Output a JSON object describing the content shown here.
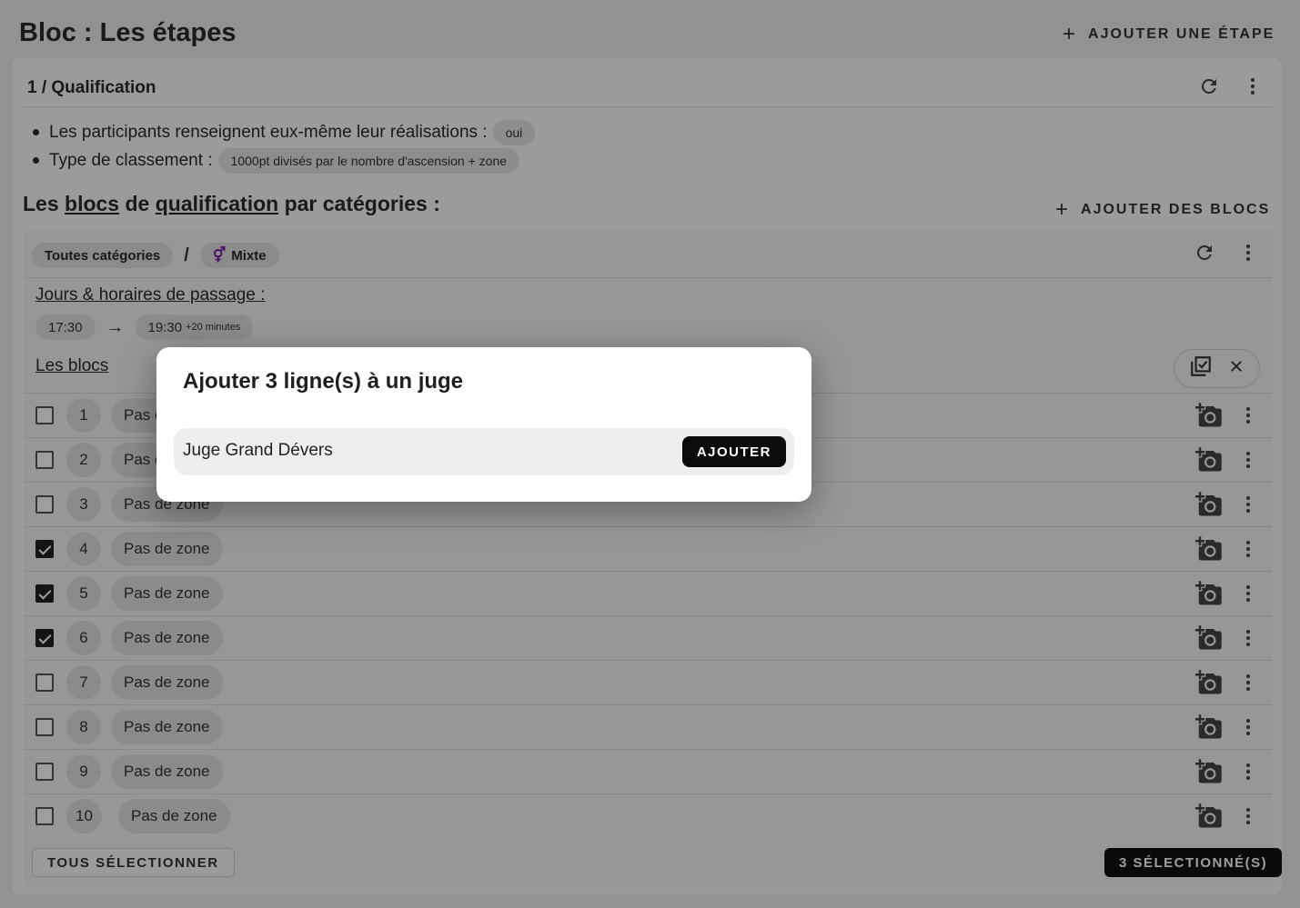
{
  "page": {
    "title": "Bloc : Les étapes",
    "add_step_label": "AJOUTER UNE ÉTAPE"
  },
  "stage": {
    "header": "1 / Qualification",
    "settings": [
      {
        "label": "Les participants renseignent eux-même leur réalisations :",
        "value": "oui"
      },
      {
        "label": "Type de classement :",
        "value": "1000pt divisés par le nombre d'ascension + zone"
      }
    ]
  },
  "section": {
    "title_prefix": "Les",
    "title_blocs": "blocs",
    "title_mid": "de",
    "title_qualif": "qualification",
    "title_suffix": "par catégories :",
    "add_blocks_label": "AJOUTER DES BLOCS"
  },
  "category": {
    "name": "Toutes catégories",
    "separator": "/",
    "gender": "Mixte",
    "gender_icon": "gender-mixed-icon",
    "gender_color": "#7b1fa2"
  },
  "schedule": {
    "title": "Jours & horaires de passage :",
    "start": "17:30",
    "end": "19:30",
    "end_extra": "+20 minutes"
  },
  "blocs": {
    "title": "Les blocs",
    "rows": [
      {
        "num": "1",
        "zone": "Pas de zone",
        "checked": false
      },
      {
        "num": "2",
        "zone": "Pas de zone",
        "checked": false
      },
      {
        "num": "3",
        "zone": "Pas de zone",
        "checked": false
      },
      {
        "num": "4",
        "zone": "Pas de zone",
        "checked": true
      },
      {
        "num": "5",
        "zone": "Pas de zone",
        "checked": true
      },
      {
        "num": "6",
        "zone": "Pas de zone",
        "checked": true
      },
      {
        "num": "7",
        "zone": "Pas de zone",
        "checked": false
      },
      {
        "num": "8",
        "zone": "Pas de zone",
        "checked": false
      },
      {
        "num": "9",
        "zone": "Pas de zone",
        "checked": false
      },
      {
        "num": "10",
        "zone": "Pas de zone",
        "checked": false
      }
    ],
    "select_all_label": "TOUS SÉLECTIONNER",
    "selected_count_label": "3 SÉLECTIONNÉ(S)"
  },
  "dialog": {
    "title": "Ajouter 3 ligne(s) à un juge",
    "judge_name": "Juge Grand Dévers",
    "add_label": "AJOUTER"
  }
}
